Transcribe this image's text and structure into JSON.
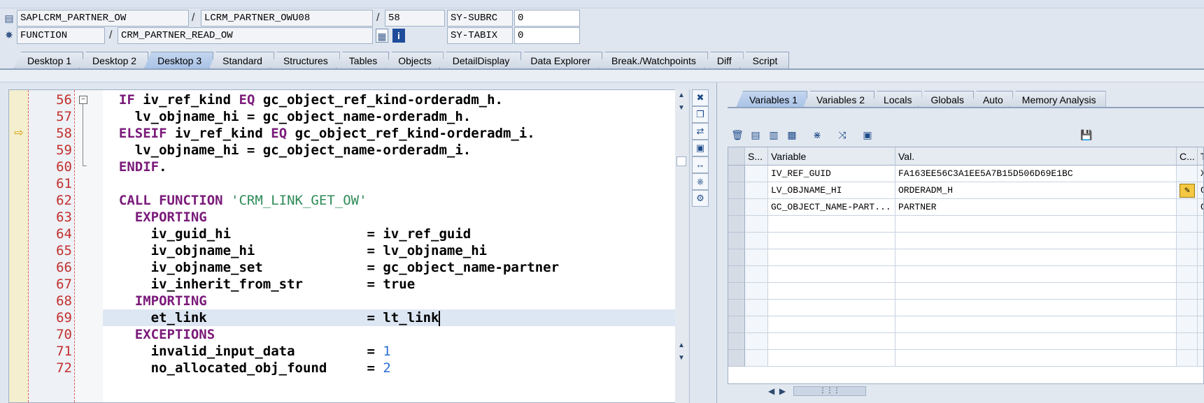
{
  "header": {
    "program": "SAPLCRM_PARTNER_OW",
    "include": "LCRM_PARTNER_OWU08",
    "line": "58",
    "sy_subrc_label": "SY-SUBRC",
    "sy_subrc_value": "0",
    "event_type": "FUNCTION",
    "event_name": "CRM_PARTNER_READ_OW",
    "sy_tabix_label": "SY-TABIX",
    "sy_tabix_value": "0",
    "slash": "/"
  },
  "tabs": [
    "Desktop 1",
    "Desktop 2",
    "Desktop 3",
    "Standard",
    "Structures",
    "Tables",
    "Objects",
    "DetailDisplay",
    "Data Explorer",
    "Break./Watchpoints",
    "Diff",
    "Script"
  ],
  "active_tab": "Desktop 3",
  "editor": {
    "lines": [
      {
        "no": "56",
        "parts": [
          [
            "kw",
            "IF "
          ],
          [
            "",
            "iv_ref_kind "
          ],
          [
            "kw",
            "EQ "
          ],
          [
            "",
            "gc_object_ref_kind-orderadm_h."
          ]
        ],
        "indent": "  "
      },
      {
        "no": "57",
        "parts": [
          [
            "",
            "lv_objname_hi = gc_object_name-orderadm_h."
          ]
        ],
        "indent": "    "
      },
      {
        "no": "58",
        "parts": [
          [
            "kw",
            "ELSEIF "
          ],
          [
            "",
            "iv_ref_kind "
          ],
          [
            "kw",
            "EQ "
          ],
          [
            "",
            "gc_object_ref_kind-orderadm_i."
          ]
        ],
        "indent": "  "
      },
      {
        "no": "59",
        "parts": [
          [
            "",
            "lv_objname_hi = gc_object_name-orderadm_i."
          ]
        ],
        "indent": "    "
      },
      {
        "no": "60",
        "parts": [
          [
            "kw",
            "ENDIF"
          ],
          [
            "",
            "."
          ]
        ],
        "indent": "  "
      },
      {
        "no": "61",
        "parts": [],
        "indent": ""
      },
      {
        "no": "62",
        "parts": [
          [
            "kw",
            "CALL FUNCTION "
          ],
          [
            "str",
            "'CRM_LINK_GET_OW'"
          ]
        ],
        "indent": "  "
      },
      {
        "no": "63",
        "parts": [
          [
            "kw",
            "EXPORTING"
          ]
        ],
        "indent": "    "
      },
      {
        "no": "64",
        "parts": [
          [
            "",
            "iv_guid_hi                 = iv_ref_guid"
          ]
        ],
        "indent": "      "
      },
      {
        "no": "65",
        "parts": [
          [
            "",
            "iv_objname_hi              = lv_objname_hi"
          ]
        ],
        "indent": "      "
      },
      {
        "no": "66",
        "parts": [
          [
            "",
            "iv_objname_set             = gc_object_name-partner"
          ]
        ],
        "indent": "      "
      },
      {
        "no": "67",
        "parts": [
          [
            "",
            "iv_inherit_from_str        = true"
          ]
        ],
        "indent": "      "
      },
      {
        "no": "68",
        "parts": [
          [
            "kw",
            "IMPORTING"
          ]
        ],
        "indent": "    "
      },
      {
        "no": "69",
        "parts": [
          [
            "",
            "et_link                    = lt_link"
          ]
        ],
        "indent": "      "
      },
      {
        "no": "70",
        "parts": [
          [
            "kw",
            "EXCEPTIONS"
          ]
        ],
        "indent": "    "
      },
      {
        "no": "71",
        "parts": [
          [
            "",
            "invalid_input_data         = "
          ],
          [
            "num",
            "1"
          ]
        ],
        "indent": "      "
      },
      {
        "no": "72",
        "parts": [
          [
            "",
            "no_allocated_obj_found     = "
          ],
          [
            "num",
            "2"
          ]
        ],
        "indent": "      "
      }
    ],
    "current_line": "58",
    "cursor_line": "69"
  },
  "var_tabs": [
    "Variables 1",
    "Variables 2",
    "Locals",
    "Globals",
    "Auto",
    "Memory Analysis"
  ],
  "active_var_tab": "Variables 1",
  "grid": {
    "headers": [
      "S...",
      "Variable",
      "Val.",
      "C...",
      "T"
    ],
    "rows": [
      {
        "variable": "IV_REF_GUID",
        "value": "FA163EE56C3A1EE5A7B15D506D69E1BC",
        "c": "X"
      },
      {
        "variable": "LV_OBJNAME_HI",
        "value": "ORDERADM_H",
        "c": "C"
      },
      {
        "variable": "GC_OBJECT_NAME-PART...",
        "value": "PARTNER",
        "c": "C"
      }
    ]
  },
  "colors": {
    "keyword": "#7a1a7a",
    "string": "#2e8b57",
    "number": "#2a6fd6",
    "line_no": "#c23030"
  }
}
